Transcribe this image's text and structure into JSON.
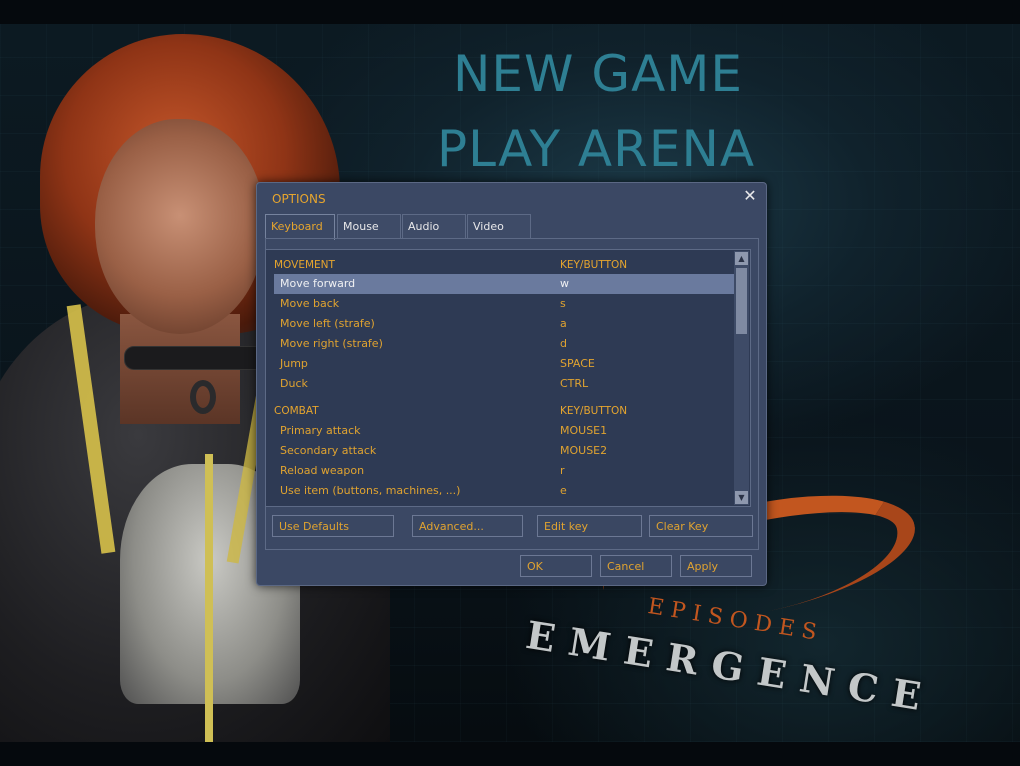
{
  "menu": {
    "new_game": "NEW GAME",
    "play_arena": "PLAY ARENA"
  },
  "branding": {
    "logo_text": "EMERGENCE",
    "logo_sub": "EPISODES"
  },
  "dialog": {
    "title": "OPTIONS",
    "close_glyph": "✕",
    "tabs": [
      {
        "label": "Keyboard",
        "active": true
      },
      {
        "label": "Mouse",
        "active": false
      },
      {
        "label": "Audio",
        "active": false
      },
      {
        "label": "Video",
        "active": false
      }
    ],
    "columns": {
      "action": "MOVEMENT",
      "key": "KEY/BUTTON"
    },
    "sections": [
      {
        "name": "MOVEMENT",
        "key_header": "KEY/BUTTON",
        "rows": [
          {
            "action": "Move forward",
            "key": "w",
            "selected": true
          },
          {
            "action": "Move back",
            "key": "s"
          },
          {
            "action": "Move left (strafe)",
            "key": "a"
          },
          {
            "action": "Move right (strafe)",
            "key": "d"
          },
          {
            "action": "Jump",
            "key": "SPACE"
          },
          {
            "action": "Duck",
            "key": "CTRL"
          }
        ]
      },
      {
        "name": "COMBAT",
        "key_header": "KEY/BUTTON",
        "rows": [
          {
            "action": "Primary attack",
            "key": "MOUSE1"
          },
          {
            "action": "Secondary attack",
            "key": "MOUSE2"
          },
          {
            "action": "Reload weapon",
            "key": "r"
          },
          {
            "action": "Use item (buttons, machines, ...)",
            "key": "e"
          }
        ]
      }
    ],
    "scroll_up_glyph": "▲",
    "scroll_down_glyph": "▼",
    "panel_buttons": {
      "use_defaults": "Use Defaults",
      "advanced": "Advanced...",
      "edit_key": "Edit key",
      "clear_key": "Clear Key"
    },
    "footer_buttons": {
      "ok": "OK",
      "cancel": "Cancel",
      "apply": "Apply"
    }
  },
  "colors": {
    "menu_text": "#2e7f93",
    "dialog_bg": "#3b4864",
    "accent_text": "#e0a330",
    "selection": "#6a7a9e"
  }
}
